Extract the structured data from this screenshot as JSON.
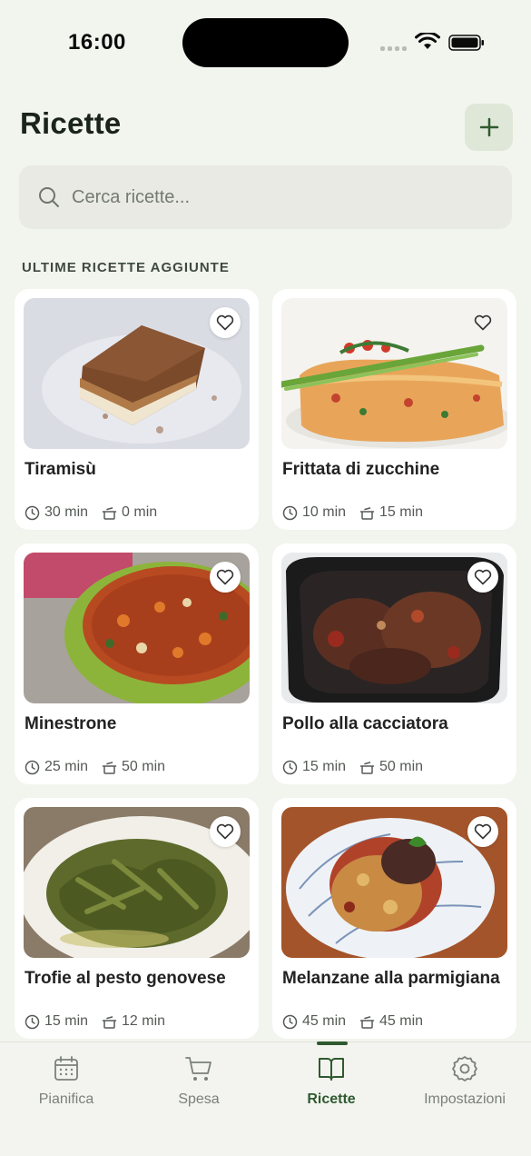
{
  "status_bar": {
    "time": "16:00"
  },
  "header": {
    "title": "Ricette",
    "add_icon": "plus-icon"
  },
  "search": {
    "placeholder": "Cerca ricette..."
  },
  "section": {
    "title": "ULTIME RICETTE AGGIUNTE"
  },
  "recipes": [
    {
      "title": "Tiramisù",
      "prep": "30 min",
      "cook": "0 min"
    },
    {
      "title": "Frittata di zucchine",
      "prep": "10 min",
      "cook": "15 min"
    },
    {
      "title": "Minestrone",
      "prep": "25 min",
      "cook": "50 min"
    },
    {
      "title": "Pollo alla cacciatora",
      "prep": "15 min",
      "cook": "50 min"
    },
    {
      "title": "Trofie al pesto genovese",
      "prep": "15 min",
      "cook": "12 min"
    },
    {
      "title": "Melanzane alla parmigiana",
      "prep": "45 min",
      "cook": "45 min"
    }
  ],
  "tabs": [
    {
      "label": "Pianifica",
      "icon": "calendar-icon"
    },
    {
      "label": "Spesa",
      "icon": "cart-icon"
    },
    {
      "label": "Ricette",
      "icon": "book-icon",
      "active": true
    },
    {
      "label": "Impostazioni",
      "icon": "gear-icon"
    }
  ],
  "colors": {
    "accent": "#2f5a2f",
    "background": "#f2f4ee",
    "add_button_bg": "#dfe8d8"
  }
}
